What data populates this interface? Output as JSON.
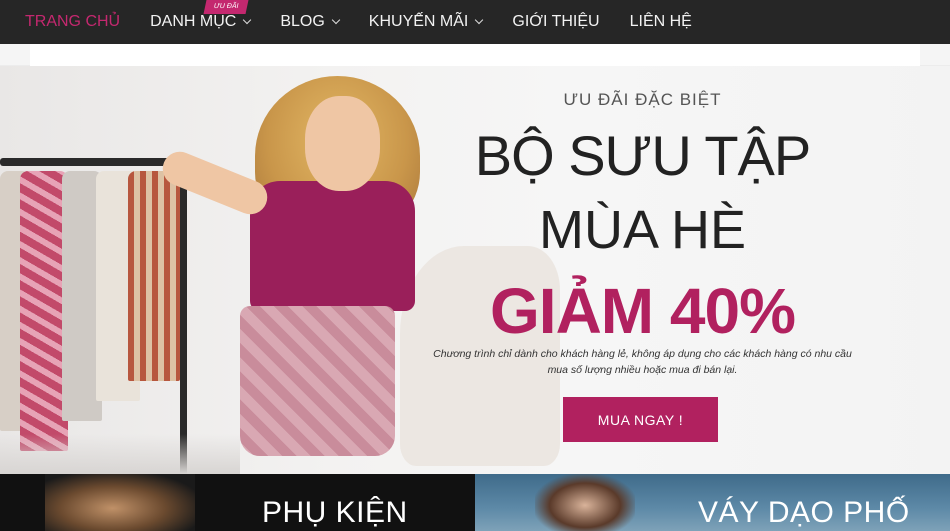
{
  "nav": {
    "items": [
      {
        "label": "TRANG CHỦ",
        "active": true,
        "dropdown": false
      },
      {
        "label": "DANH MỤC",
        "active": false,
        "dropdown": true
      },
      {
        "label": "BLOG",
        "active": false,
        "dropdown": true
      },
      {
        "label": "KHUYẾN MÃI",
        "active": false,
        "dropdown": true
      },
      {
        "label": "GIỚI THIỆU",
        "active": false,
        "dropdown": false
      },
      {
        "label": "LIÊN HỆ",
        "active": false,
        "dropdown": false
      }
    ],
    "badge": "ƯU ĐÃI"
  },
  "hero": {
    "eyebrow": "ƯU ĐÃI ĐẶC BIỆT",
    "line1": "BỘ SƯU TẬP",
    "line2": "MÙA HÈ",
    "line3": "GIẢM 40%",
    "description": "Chương trình chỉ dành cho khách hàng lẻ, không áp dụng cho các khách hàng có nhu cầu mua số lượng nhiều hoặc mua đi bán lại.",
    "cta": "MUA NGAY !"
  },
  "banners": [
    {
      "title": "PHỤ KIỆN"
    },
    {
      "title": "VÁY DẠO PHỐ"
    }
  ],
  "colors": {
    "accent": "#b1215f",
    "nav_bg": "#262626",
    "active_nav": "#c4286f"
  }
}
